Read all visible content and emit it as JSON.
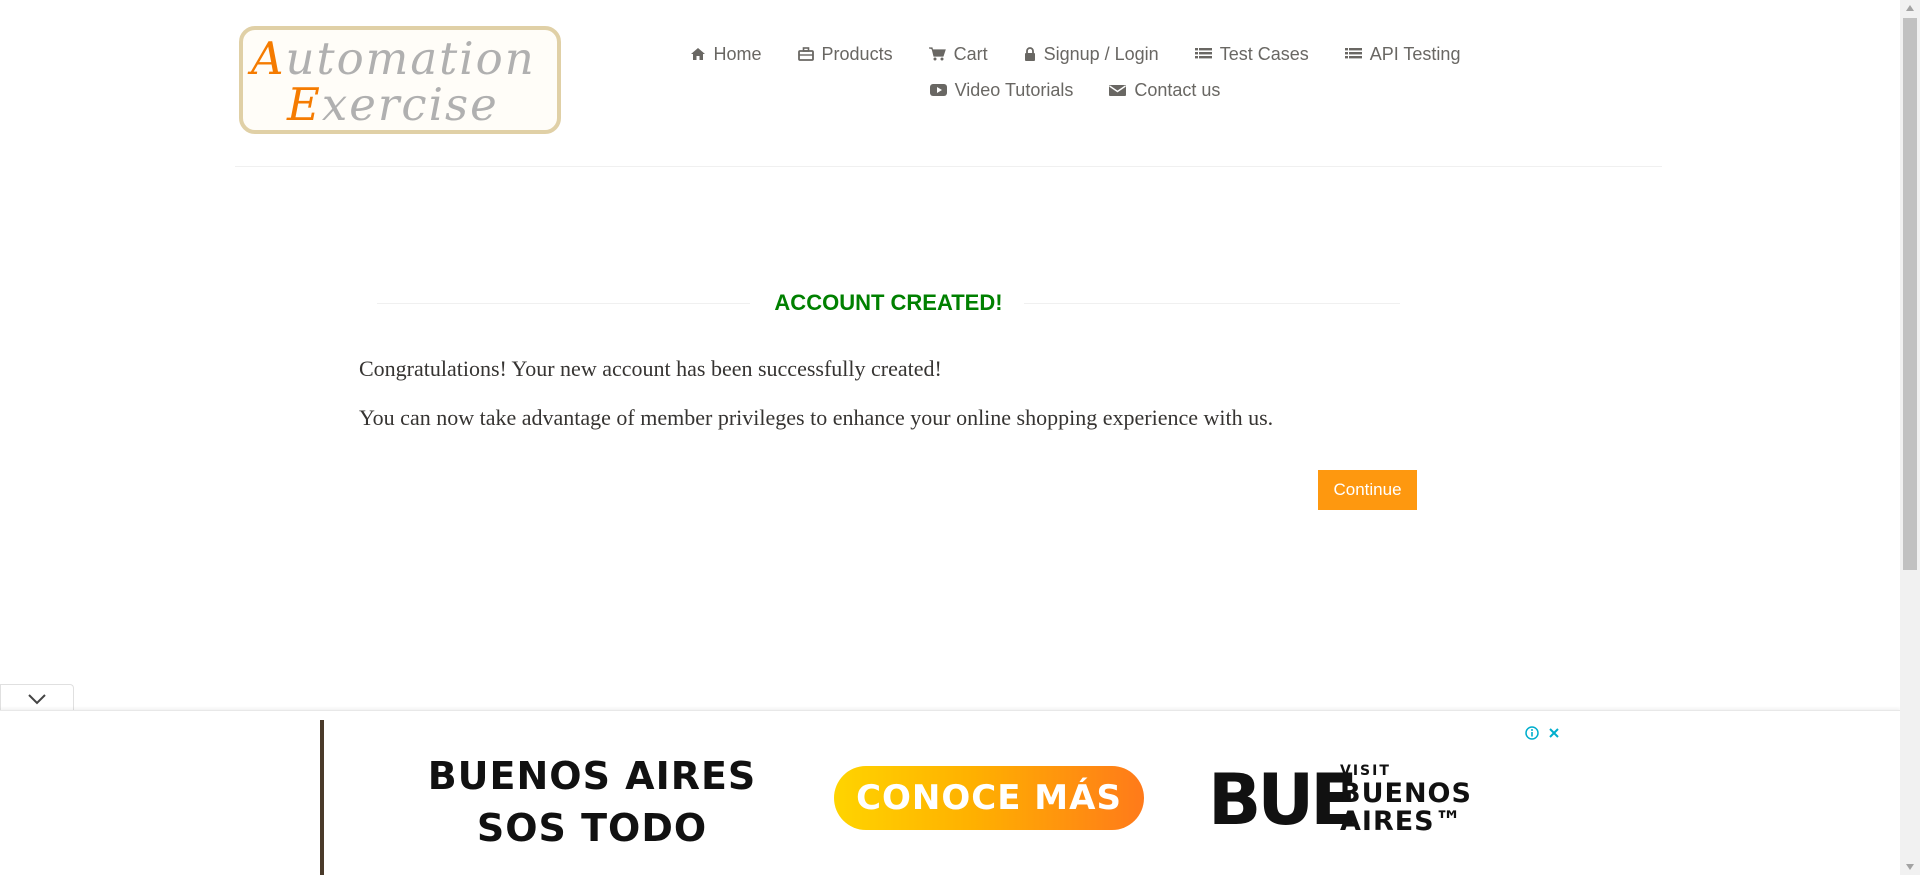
{
  "logo": {
    "line1_cap": "A",
    "line1_rest": "utomation",
    "line2_cap": "E",
    "line2_rest": "xercise"
  },
  "nav": {
    "row1": [
      {
        "label": "Home",
        "icon": "home-icon"
      },
      {
        "label": "Products",
        "icon": "briefcase-icon"
      },
      {
        "label": "Cart",
        "icon": "cart-icon"
      },
      {
        "label": "Signup / Login",
        "icon": "lock-icon"
      },
      {
        "label": "Test Cases",
        "icon": "list-icon"
      },
      {
        "label": "API Testing",
        "icon": "list-icon"
      }
    ],
    "row2": [
      {
        "label": "Video Tutorials",
        "icon": "youtube-play-icon"
      },
      {
        "label": "Contact us",
        "icon": "envelope-icon"
      }
    ]
  },
  "main": {
    "title": "ACCOUNT CREATED!",
    "message1": "Congratulations! Your new account has been successfully created!",
    "message2": "You can now take advantage of member privileges to enhance your online shopping experience with us.",
    "continue_label": "Continue"
  },
  "ad": {
    "headline_line1": "BUENOS AIRES",
    "headline_line2": "SOS TODO",
    "cta": "CONOCE MÁS",
    "logo_mark": "BUE",
    "logo_small": "VISIT",
    "logo_line1": "BUENOS",
    "logo_line2": "AIRES™"
  },
  "colors": {
    "accent": "#fe980f",
    "title_green": "#008000",
    "nav_text": "#696763"
  }
}
